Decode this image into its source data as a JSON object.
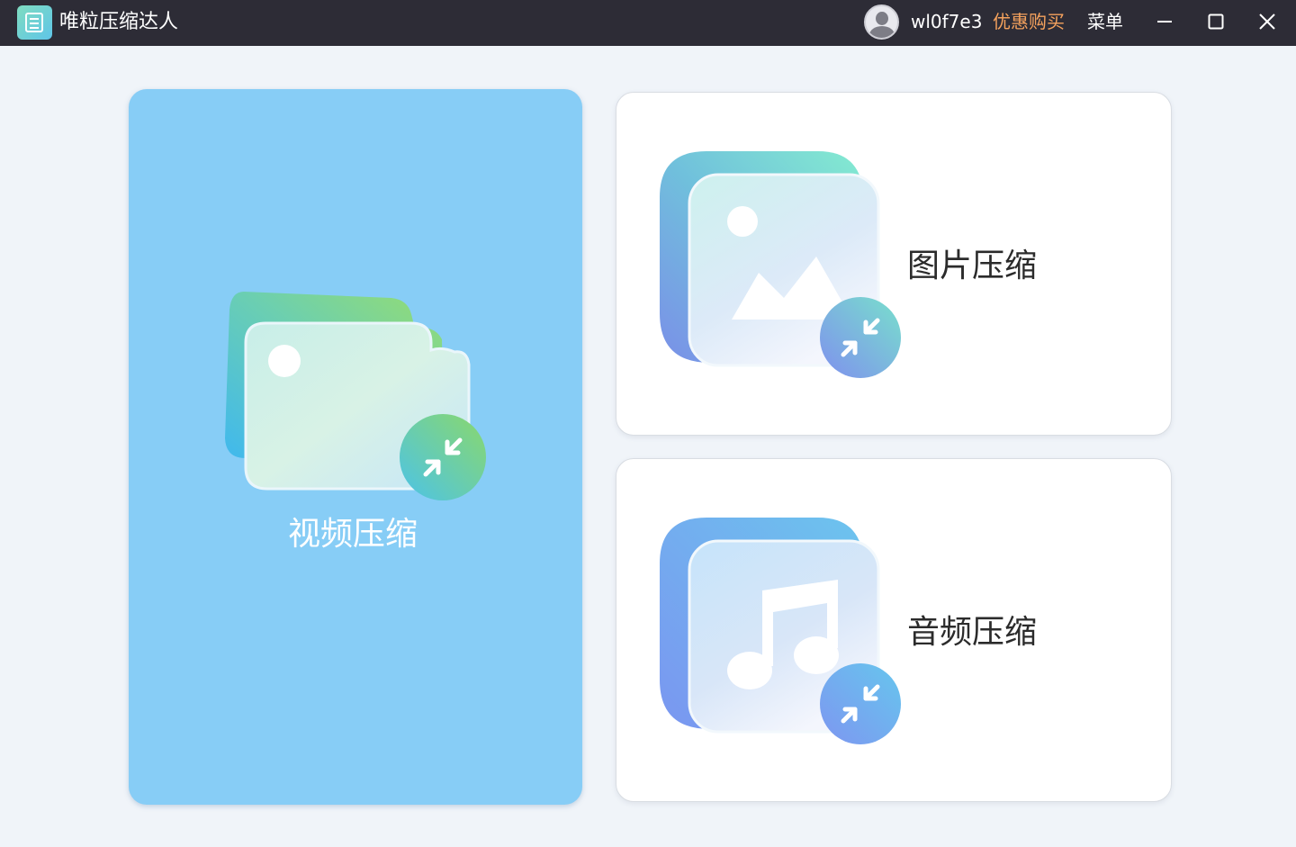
{
  "titlebar": {
    "app_title": "唯粒压缩达人",
    "username": "wl0f7e3",
    "promo_label": "优惠购买",
    "menu_label": "菜单"
  },
  "cards": {
    "video": {
      "label": "视频压缩"
    },
    "image": {
      "label": "图片压缩"
    },
    "audio": {
      "label": "音频压缩"
    }
  },
  "colors": {
    "titlebar_bg": "#2d2c36",
    "promo": "#f5a25d",
    "video_card_bg": "#87cdf6",
    "page_bg": "#f0f4f9"
  },
  "icons": [
    "app-logo-icon",
    "avatar-icon",
    "minimize-icon",
    "maximize-icon",
    "close-icon",
    "video-file-icon",
    "image-file-icon",
    "music-file-icon",
    "compress-icon"
  ]
}
